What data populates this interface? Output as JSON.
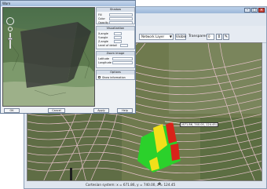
{
  "back_window": {
    "layer_select": "Network Layer",
    "visible_label": "Visible",
    "transparency_label": "Transparency",
    "transparency_value": "0",
    "coordinate_callout": "(671.86, 740.00, 124.45)",
    "status_text": "Cartesian system: x = 671.86, y = 740.00, z = 124.45"
  },
  "front_window": {
    "title": "Warn",
    "panel": {
      "section1": "Shadow",
      "section2": "Visualization",
      "section3": "Zoom image",
      "section4": "Options",
      "field_rows": [
        "Fill",
        "Color",
        "Opacity"
      ],
      "vis_rows": [
        "X-angle",
        "Y-angle",
        "Z-angle",
        "Level of detail"
      ],
      "zoom_rows": [
        "Latitude",
        "Longitude"
      ],
      "option_label": "Show information"
    },
    "footer_buttons": [
      "OK",
      "Cancel",
      "Apply",
      "Help"
    ]
  },
  "colors": {
    "contour": "#e5c1c9",
    "terrain_green": "#2bd12b",
    "terrain_yellow": "#f2e01a",
    "terrain_red": "#d8231a"
  }
}
